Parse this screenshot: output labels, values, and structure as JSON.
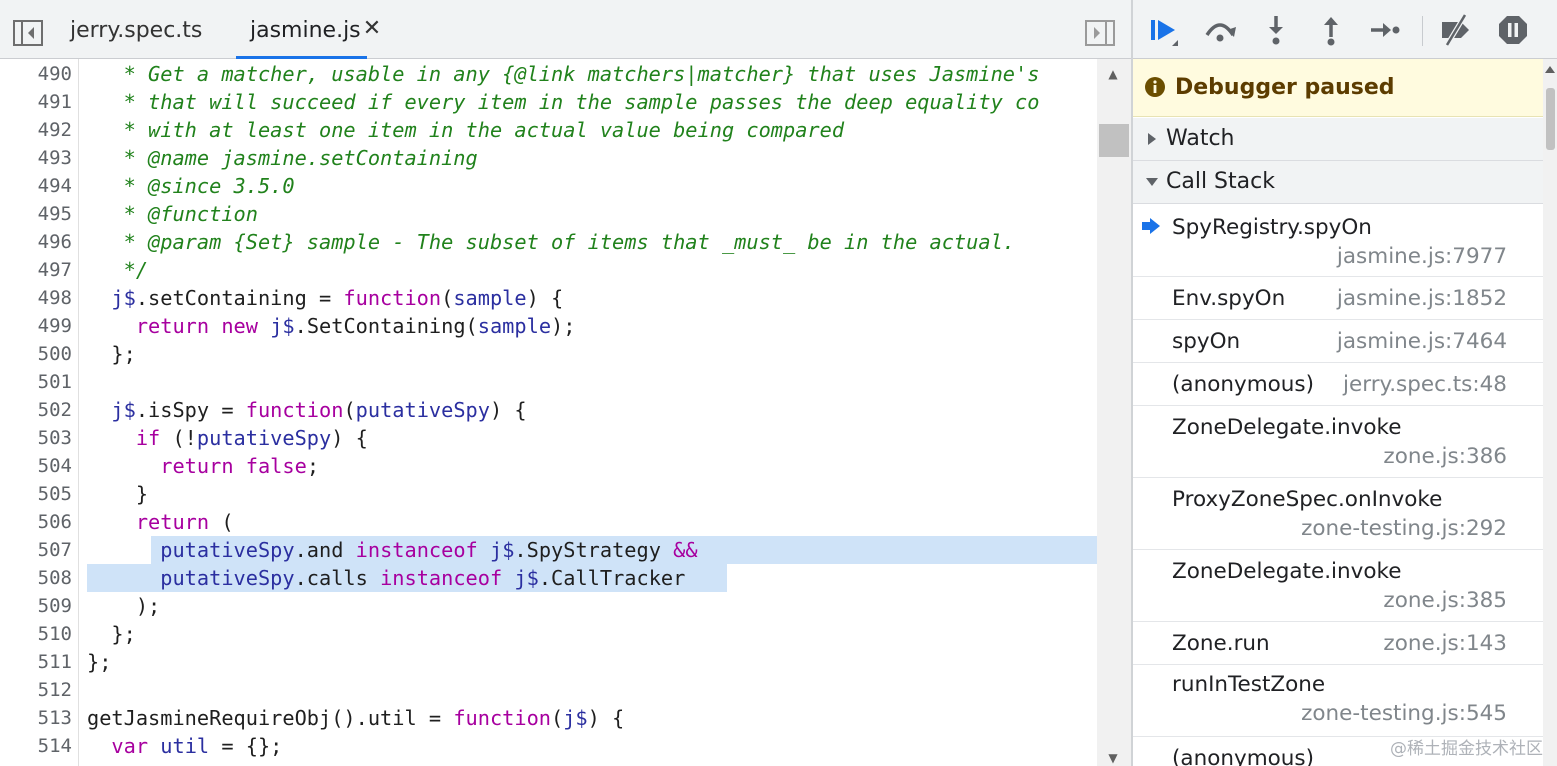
{
  "editor": {
    "tabs": [
      {
        "label": "jerry.spec.ts",
        "active": false
      },
      {
        "label": "jasmine.js",
        "active": true
      }
    ],
    "close_glyph": "✕",
    "code_lines": [
      {
        "number": "490",
        "tokens": [
          {
            "t": "   * Get a matcher, usable in any {@link matchers|matcher} that uses Jasmine's",
            "c": "cm"
          }
        ]
      },
      {
        "number": "491",
        "tokens": [
          {
            "t": "   * that will succeed if every item in the sample passes the deep equality co",
            "c": "cm"
          }
        ]
      },
      {
        "number": "492",
        "tokens": [
          {
            "t": "   * with at least one item in the actual value being compared",
            "c": "cm"
          }
        ]
      },
      {
        "number": "493",
        "tokens": [
          {
            "t": "   * @name jasmine.setContaining",
            "c": "cm"
          }
        ]
      },
      {
        "number": "494",
        "tokens": [
          {
            "t": "   * @since 3.5.0",
            "c": "cm"
          }
        ]
      },
      {
        "number": "495",
        "tokens": [
          {
            "t": "   * @function",
            "c": "cm"
          }
        ]
      },
      {
        "number": "496",
        "tokens": [
          {
            "t": "   * @param {Set} sample - The subset of items that _must_ be in the actual.",
            "c": "cm"
          }
        ]
      },
      {
        "number": "497",
        "tokens": [
          {
            "t": "   */",
            "c": "cm"
          }
        ]
      },
      {
        "number": "498",
        "tokens": [
          {
            "t": "  ",
            "c": ""
          },
          {
            "t": "j$",
            "c": "vr"
          },
          {
            "t": ".setContaining = ",
            "c": ""
          },
          {
            "t": "function",
            "c": "kw"
          },
          {
            "t": "(",
            "c": ""
          },
          {
            "t": "sample",
            "c": "vr"
          },
          {
            "t": ") {",
            "c": ""
          }
        ]
      },
      {
        "number": "499",
        "tokens": [
          {
            "t": "    ",
            "c": ""
          },
          {
            "t": "return",
            "c": "kw"
          },
          {
            "t": " ",
            "c": ""
          },
          {
            "t": "new",
            "c": "kw"
          },
          {
            "t": " ",
            "c": ""
          },
          {
            "t": "j$",
            "c": "vr"
          },
          {
            "t": ".SetContaining(",
            "c": ""
          },
          {
            "t": "sample",
            "c": "vr"
          },
          {
            "t": ");",
            "c": ""
          }
        ]
      },
      {
        "number": "500",
        "tokens": [
          {
            "t": "  };",
            "c": ""
          }
        ]
      },
      {
        "number": "501",
        "tokens": []
      },
      {
        "number": "502",
        "tokens": [
          {
            "t": "  ",
            "c": ""
          },
          {
            "t": "j$",
            "c": "vr"
          },
          {
            "t": ".isSpy = ",
            "c": ""
          },
          {
            "t": "function",
            "c": "kw"
          },
          {
            "t": "(",
            "c": ""
          },
          {
            "t": "putativeSpy",
            "c": "vr"
          },
          {
            "t": ") {",
            "c": ""
          }
        ]
      },
      {
        "number": "503",
        "tokens": [
          {
            "t": "    ",
            "c": ""
          },
          {
            "t": "if",
            "c": "kw"
          },
          {
            "t": " (!",
            "c": ""
          },
          {
            "t": "putativeSpy",
            "c": "vr"
          },
          {
            "t": ") {",
            "c": ""
          }
        ]
      },
      {
        "number": "504",
        "tokens": [
          {
            "t": "      ",
            "c": ""
          },
          {
            "t": "return",
            "c": "kw"
          },
          {
            "t": " ",
            "c": ""
          },
          {
            "t": "false",
            "c": "kw"
          },
          {
            "t": ";",
            "c": ""
          }
        ]
      },
      {
        "number": "505",
        "tokens": [
          {
            "t": "    }",
            "c": ""
          }
        ]
      },
      {
        "number": "506",
        "tokens": [
          {
            "t": "    ",
            "c": ""
          },
          {
            "t": "return",
            "c": "kw"
          },
          {
            "t": " (",
            "c": ""
          }
        ]
      },
      {
        "number": "507",
        "tokens": [
          {
            "t": "      ",
            "c": ""
          },
          {
            "t": "putativeSpy",
            "c": "vr"
          },
          {
            "t": ".and ",
            "c": ""
          },
          {
            "t": "instanceof",
            "c": "kw"
          },
          {
            "t": " ",
            "c": ""
          },
          {
            "t": "j$",
            "c": "vr"
          },
          {
            "t": ".SpyStrategy ",
            "c": ""
          },
          {
            "t": "&&",
            "c": "kw"
          }
        ]
      },
      {
        "number": "508",
        "tokens": [
          {
            "t": "      ",
            "c": ""
          },
          {
            "t": "putativeSpy",
            "c": "vr"
          },
          {
            "t": ".calls ",
            "c": ""
          },
          {
            "t": "instanceof",
            "c": "kw"
          },
          {
            "t": " ",
            "c": ""
          },
          {
            "t": "j$",
            "c": "vr"
          },
          {
            "t": ".CallTracker",
            "c": ""
          }
        ]
      },
      {
        "number": "509",
        "tokens": [
          {
            "t": "    );",
            "c": ""
          }
        ]
      },
      {
        "number": "510",
        "tokens": [
          {
            "t": "  };",
            "c": ""
          }
        ]
      },
      {
        "number": "511",
        "tokens": [
          {
            "t": "};",
            "c": ""
          }
        ]
      },
      {
        "number": "512",
        "tokens": []
      },
      {
        "number": "513",
        "tokens": [
          {
            "t": "getJasmineRequireObj().util = ",
            "c": ""
          },
          {
            "t": "function",
            "c": "kw"
          },
          {
            "t": "(",
            "c": ""
          },
          {
            "t": "j$",
            "c": "vr"
          },
          {
            "t": ") {",
            "c": ""
          }
        ]
      },
      {
        "number": "514",
        "tokens": [
          {
            "t": "  ",
            "c": ""
          },
          {
            "t": "var",
            "c": "kw"
          },
          {
            "t": " ",
            "c": ""
          },
          {
            "t": "util",
            "c": "vr"
          },
          {
            "t": " = {};",
            "c": ""
          }
        ]
      }
    ]
  },
  "debugger": {
    "toolbar_icons": [
      "resume-icon",
      "step-over-icon",
      "step-into-icon",
      "step-out-icon",
      "step-icon",
      "deactivate-breakpoints-icon",
      "pause-on-exceptions-icon"
    ],
    "status": "Debugger paused",
    "sections": {
      "watch": "Watch",
      "call_stack": "Call Stack"
    },
    "call_stack": [
      {
        "name": "SpyRegistry.spyOn",
        "location": "jasmine.js:7977",
        "current": true
      },
      {
        "name": "Env.spyOn",
        "location": "jasmine.js:1852",
        "current": false
      },
      {
        "name": "spyOn",
        "location": "jasmine.js:7464",
        "current": false
      },
      {
        "name": "(anonymous)",
        "location": "jerry.spec.ts:48",
        "current": false
      },
      {
        "name": "ZoneDelegate.invoke",
        "location": "zone.js:386",
        "current": false
      },
      {
        "name": "ProxyZoneSpec.onInvoke",
        "location": "zone-testing.js:292",
        "current": false
      },
      {
        "name": "ZoneDelegate.invoke",
        "location": "zone.js:385",
        "current": false
      },
      {
        "name": "Zone.run",
        "location": "zone.js:143",
        "current": false
      },
      {
        "name": "runInTestZone",
        "location": "zone-testing.js:545",
        "current": false
      },
      {
        "name": "(anonymous)",
        "location": "",
        "current": false
      }
    ]
  },
  "watermark": "@稀土掘金技术社区",
  "colors": {
    "comment": "#21821c",
    "keyword": "#a7009f",
    "variable": "#2b2fa0",
    "selection": "#cfe3f8",
    "accent": "#1a73e8",
    "paused_bg": "#fffbdf"
  }
}
